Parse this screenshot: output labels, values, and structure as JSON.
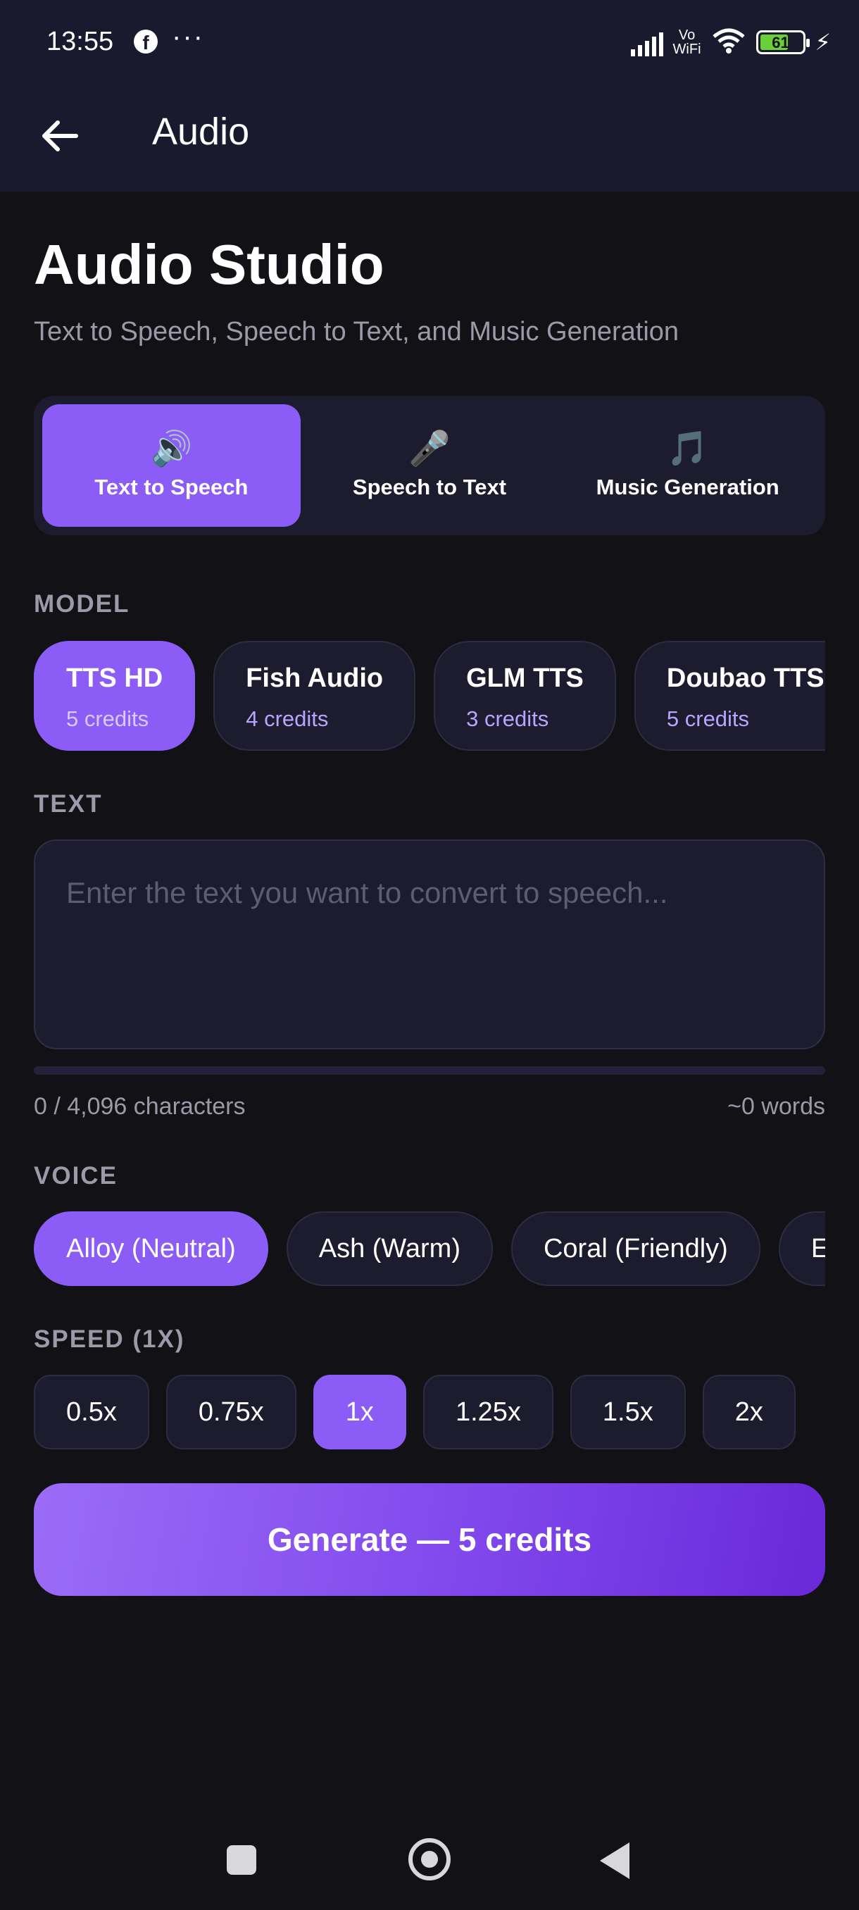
{
  "status_bar": {
    "time": "13:55",
    "dots": "···",
    "vowifi": "Vo\nWiFi",
    "battery": "61",
    "battery_level": 0.61
  },
  "app_bar": {
    "title": "Audio"
  },
  "header": {
    "title": "Audio Studio",
    "subtitle": "Text to Speech, Speech to Text, and Music Generation"
  },
  "tabs": [
    {
      "label": "Text to Speech",
      "icon": "speaker-icon",
      "glyph": "🔊",
      "active": true
    },
    {
      "label": "Speech to Text",
      "icon": "microphone-icon",
      "glyph": "🎤",
      "active": false
    },
    {
      "label": "Music Generation",
      "icon": "music-note-icon",
      "glyph": "🎵",
      "active": false
    }
  ],
  "model": {
    "label": "MODEL",
    "options": [
      {
        "name": "TTS HD",
        "credits": "5 credits",
        "active": true
      },
      {
        "name": "Fish Audio",
        "credits": "4 credits",
        "active": false
      },
      {
        "name": "GLM TTS",
        "credits": "3 credits",
        "active": false
      },
      {
        "name": "Doubao TTS HD",
        "credits": "5 credits",
        "active": false
      }
    ]
  },
  "text": {
    "label": "TEXT",
    "value": "",
    "placeholder": "Enter the text you want to convert to speech...",
    "progress": 0,
    "char_count": "0 / 4,096 characters",
    "word_count": "~0 words"
  },
  "voice": {
    "label": "VOICE",
    "options": [
      "Alloy (Neutral)",
      "Ash (Warm)",
      "Coral (Friendly)",
      "Echo"
    ],
    "selected_index": 0
  },
  "speed": {
    "label": "SPEED (1X)",
    "options": [
      "0.5x",
      "0.75x",
      "1x",
      "1.25x",
      "1.5x",
      "2x"
    ],
    "selected_index": 2
  },
  "generate_button": {
    "label": "Generate — 5 credits"
  },
  "colors": {
    "accent": "#8b5cf6",
    "background": "#121116",
    "surface": "#1c1c2e",
    "header": "#1a1a2e"
  }
}
